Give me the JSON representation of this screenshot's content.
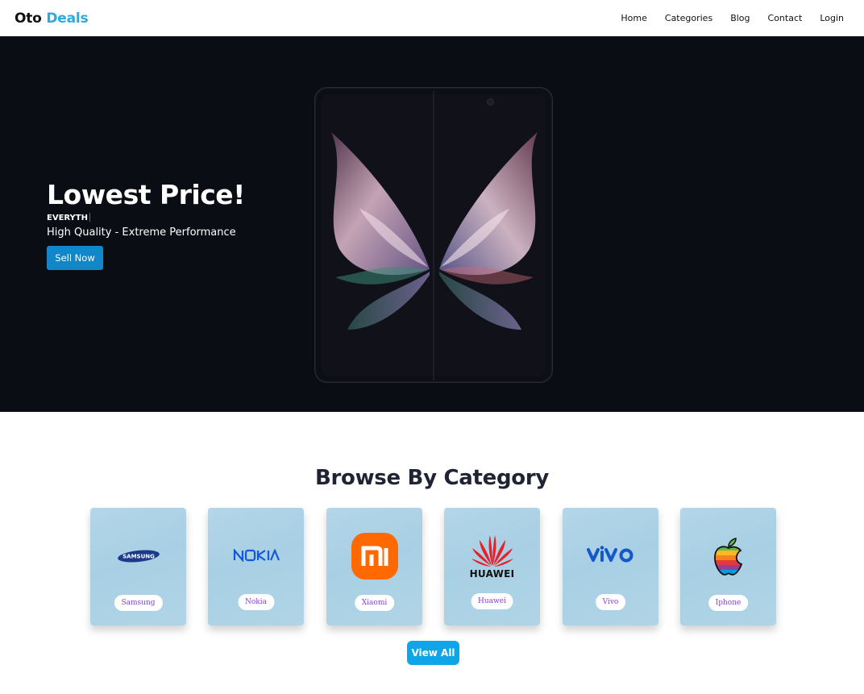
{
  "brand": {
    "part1": "Oto",
    "part2": "Deals",
    "accent_color": "#2ea8e0"
  },
  "nav": {
    "items": [
      "Home",
      "Categories",
      "Blog",
      "Contact",
      "Login"
    ]
  },
  "hero": {
    "title": "Lowest Price!",
    "typed_text": "EVERYTH",
    "subtitle": "High Quality - Extreme Performance",
    "button_label": "Sell Now",
    "button_color": "#1187c9",
    "background_color": "#0b0d15"
  },
  "categories": {
    "title": "Browse By Category",
    "items": [
      {
        "label": "Samsung",
        "icon": "samsung-logo-icon"
      },
      {
        "label": "Nokia",
        "icon": "nokia-logo-icon"
      },
      {
        "label": "Xiaomi",
        "icon": "xiaomi-logo-icon"
      },
      {
        "label": "Huawei",
        "icon": "huawei-logo-icon",
        "logo_text": "HUAWEI"
      },
      {
        "label": "Vivo",
        "icon": "vivo-logo-icon"
      },
      {
        "label": "Iphone",
        "icon": "apple-logo-icon"
      }
    ],
    "label_color": "#8a3fd0",
    "view_all_label": "View All",
    "view_all_color": "#0ea5e9"
  }
}
